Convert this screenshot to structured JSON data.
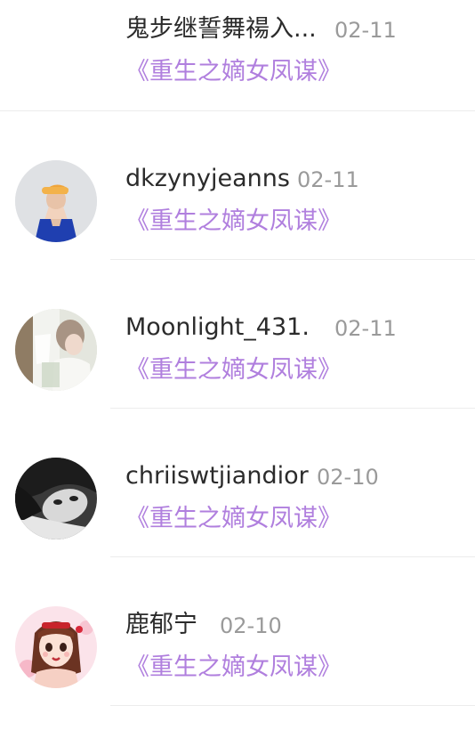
{
  "comments": [
    {
      "user": "鬼步继誓舞禓入...",
      "date": "02-11",
      "book": "《重生之嫡女凤谋》",
      "avatar": "none"
    },
    {
      "user": "dkzynyjeanns",
      "date": "02-11",
      "book": "《重生之嫡女凤谋》",
      "avatar": "avatar-photo-cap"
    },
    {
      "user": "Moonlight_431.",
      "date": "02-11",
      "book": "《重生之嫡女凤谋》",
      "avatar": "avatar-photo-illustration"
    },
    {
      "user": "chriiswtjiandior",
      "date": "02-10",
      "book": "《重生之嫡女凤谋》",
      "avatar": "avatar-photo-bw"
    },
    {
      "user": "鹿郁宁",
      "date": "02-10",
      "book": "《重生之嫡女凤谋》",
      "avatar": "avatar-cartoon-girl"
    }
  ],
  "colors": {
    "book_title": "#b07fde",
    "username": "#2b2b2b",
    "date": "#9a9a9a",
    "divider": "#ececec"
  }
}
